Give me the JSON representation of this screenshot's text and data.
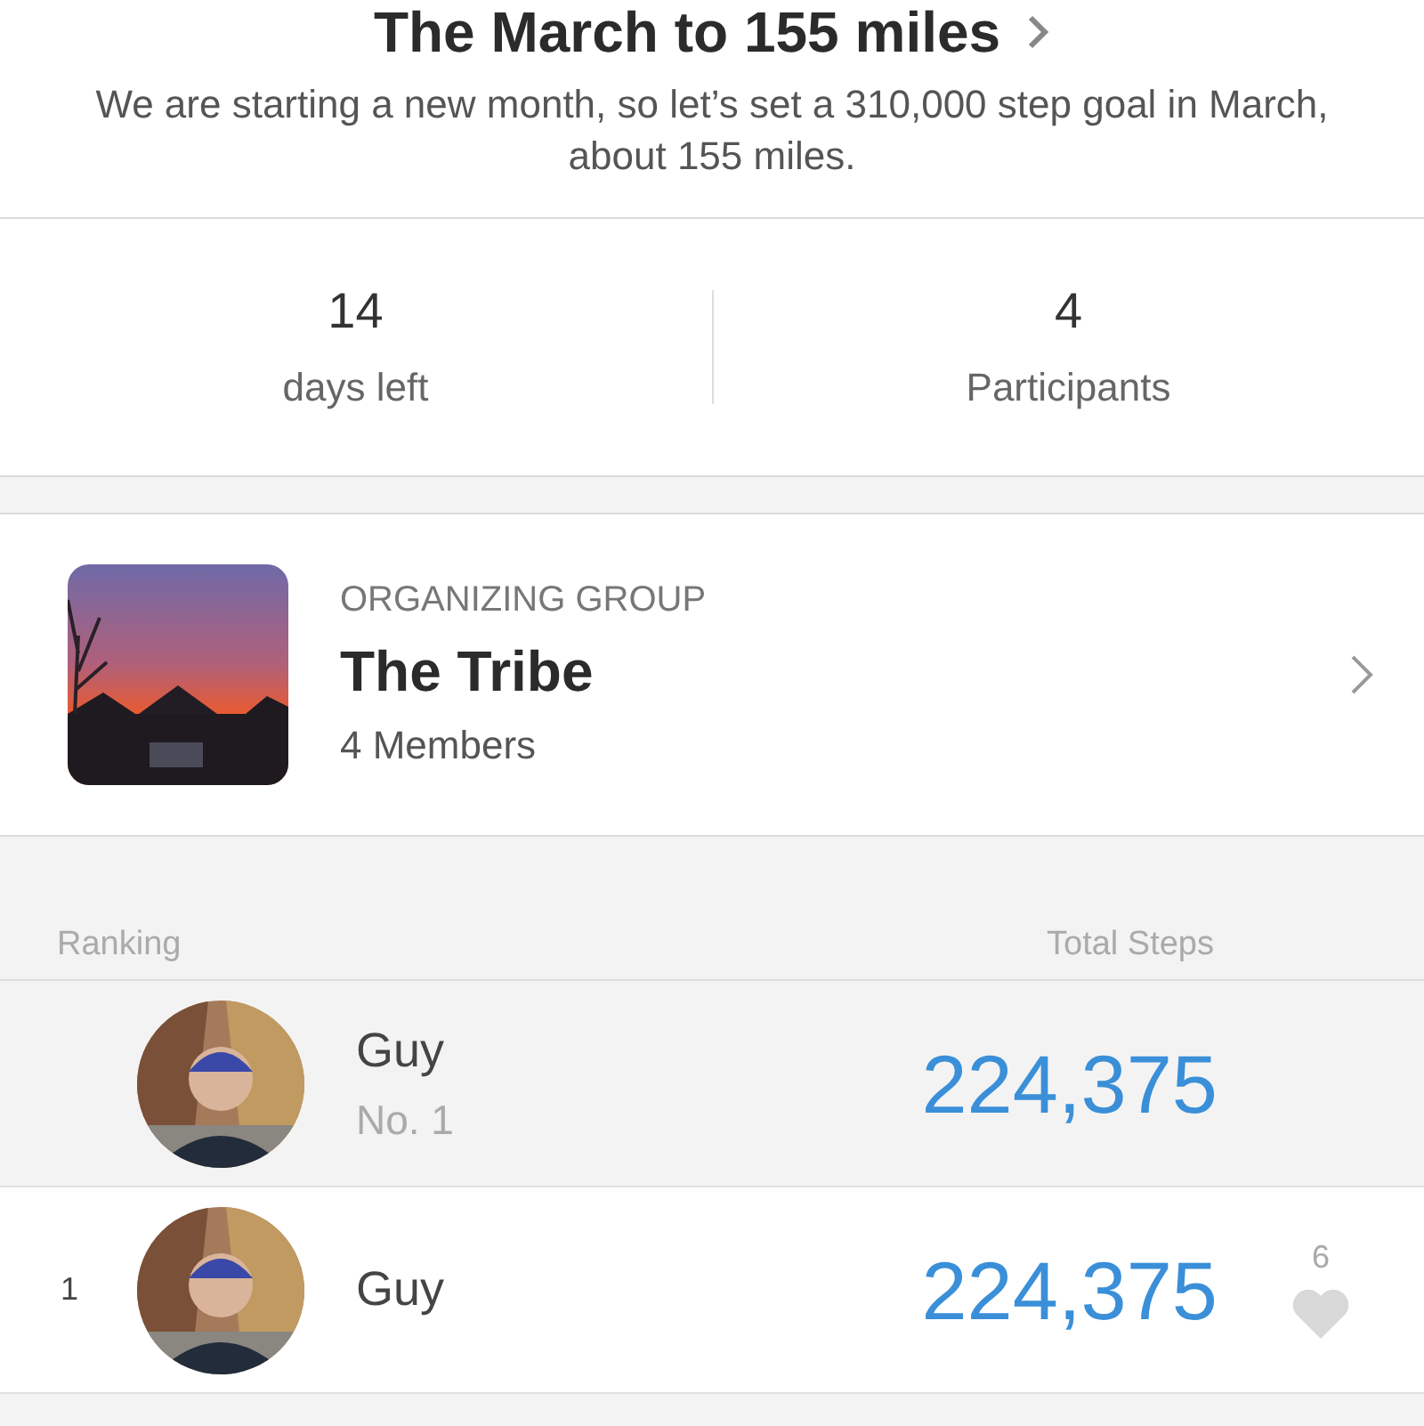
{
  "challenge": {
    "title": "The March to 155 miles",
    "description": "We are starting a new month, so let’s set a 310,000 step goal in March, about 155 miles."
  },
  "stats": [
    {
      "value": "14",
      "label": "days left"
    },
    {
      "value": "4",
      "label": "Participants"
    }
  ],
  "group": {
    "caption": "ORGANIZING GROUP",
    "name": "The Tribe",
    "members": "4 Members"
  },
  "ranking": {
    "columns": [
      "Ranking",
      "Total Steps"
    ],
    "rows": [
      {
        "kind": "self",
        "name": "Guy",
        "position": "No. 1",
        "steps": "224,375"
      },
      {
        "kind": "entry",
        "rank": "1",
        "name": "Guy",
        "steps": "224,375",
        "likes": "6",
        "liked": false
      }
    ]
  }
}
